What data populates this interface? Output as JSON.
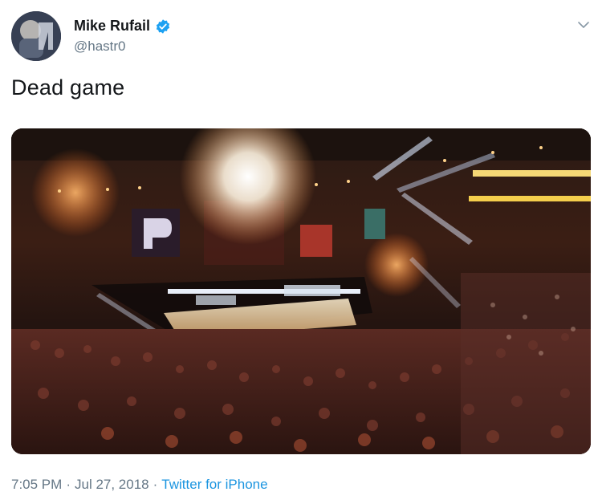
{
  "user": {
    "display_name": "Mike Rufail",
    "handle": "@hastr0",
    "verified": true
  },
  "tweet": {
    "text": "Dead game",
    "time": "7:05 PM",
    "separator": "·",
    "date": "Jul 27, 2018",
    "source": "Twitter for iPhone"
  },
  "icons": {
    "verified": "verified-badge-icon",
    "menu": "chevron-down-icon"
  },
  "colors": {
    "verified": "#1da1f2",
    "link": "#1b95e0",
    "secondary_text": "#657786",
    "primary_text": "#14171a"
  }
}
